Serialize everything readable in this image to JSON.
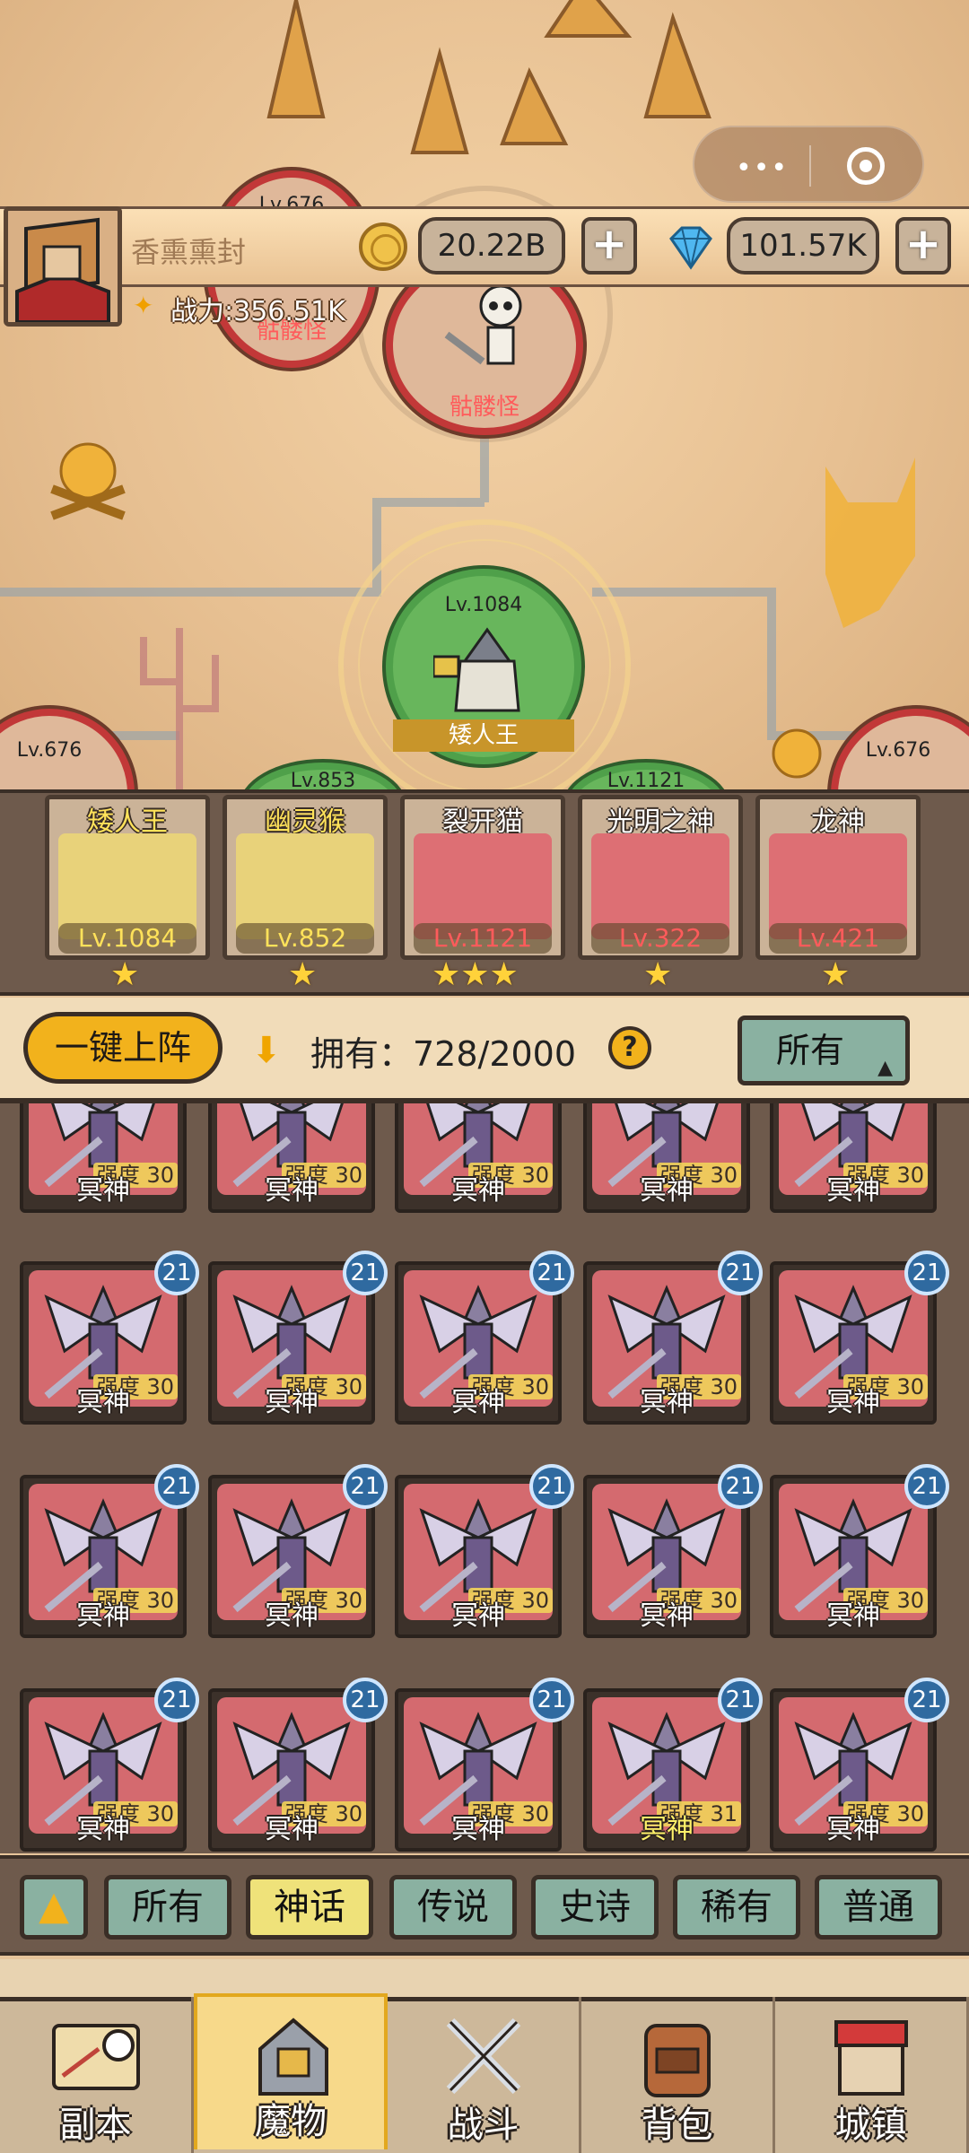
{
  "capsule": {
    "more_icon": "more-dots-icon",
    "close_icon": "target-circle-icon"
  },
  "player": {
    "name": "香熏熏封",
    "power": "战力:356.51K"
  },
  "currency": {
    "gold": "20.22B",
    "diamond": "101.57K",
    "gold_icon": "gold-coin-icon",
    "diamond_icon": "diamond-icon"
  },
  "map_nodes": {
    "top_left": {
      "level": "Lv.676",
      "name": "骷髅怪"
    },
    "top_center": {
      "name": "骷髅怪"
    },
    "center": {
      "level": "Lv.1084",
      "name": "矮人王"
    },
    "left": {
      "level": "Lv.676"
    },
    "right": {
      "level": "Lv.676"
    },
    "bottom_a": {
      "level": "Lv.853"
    },
    "bottom_b": {
      "level": "Lv.1121"
    }
  },
  "team": [
    {
      "name": "矮人王",
      "level": "Lv.1084",
      "stars": "★",
      "color": "#ffe25a"
    },
    {
      "name": "幽灵猴",
      "level": "Lv.852",
      "stars": "★",
      "color": "#ffe25a"
    },
    {
      "name": "裂开猫",
      "level": "Lv.1121",
      "stars": "★★★",
      "color": "#ff5b5b"
    },
    {
      "name": "光明之神",
      "level": "Lv.322",
      "stars": "★",
      "color": "#ff5b5b"
    },
    {
      "name": "龙神",
      "level": "Lv.421",
      "stars": "★",
      "color": "#ff5b5b"
    }
  ],
  "owned_bar": {
    "deploy": "一键上阵",
    "owned": "拥有：728/2000",
    "help": "?",
    "filter": "所有"
  },
  "cards": {
    "name": "冥神",
    "strength": "强度 30",
    "strength_special": "强度 31",
    "badge": "21"
  },
  "rarity_tabs": [
    "所有",
    "神话",
    "传说",
    "史诗",
    "稀有",
    "普通"
  ],
  "nav": [
    "副本",
    "魔物",
    "战斗",
    "背包",
    "城镇"
  ],
  "colors": {
    "accent": "#f2b21c",
    "tab_teal": "#8ab1a1",
    "frame": "#3a2e26",
    "card_red": "#d46a6f"
  }
}
